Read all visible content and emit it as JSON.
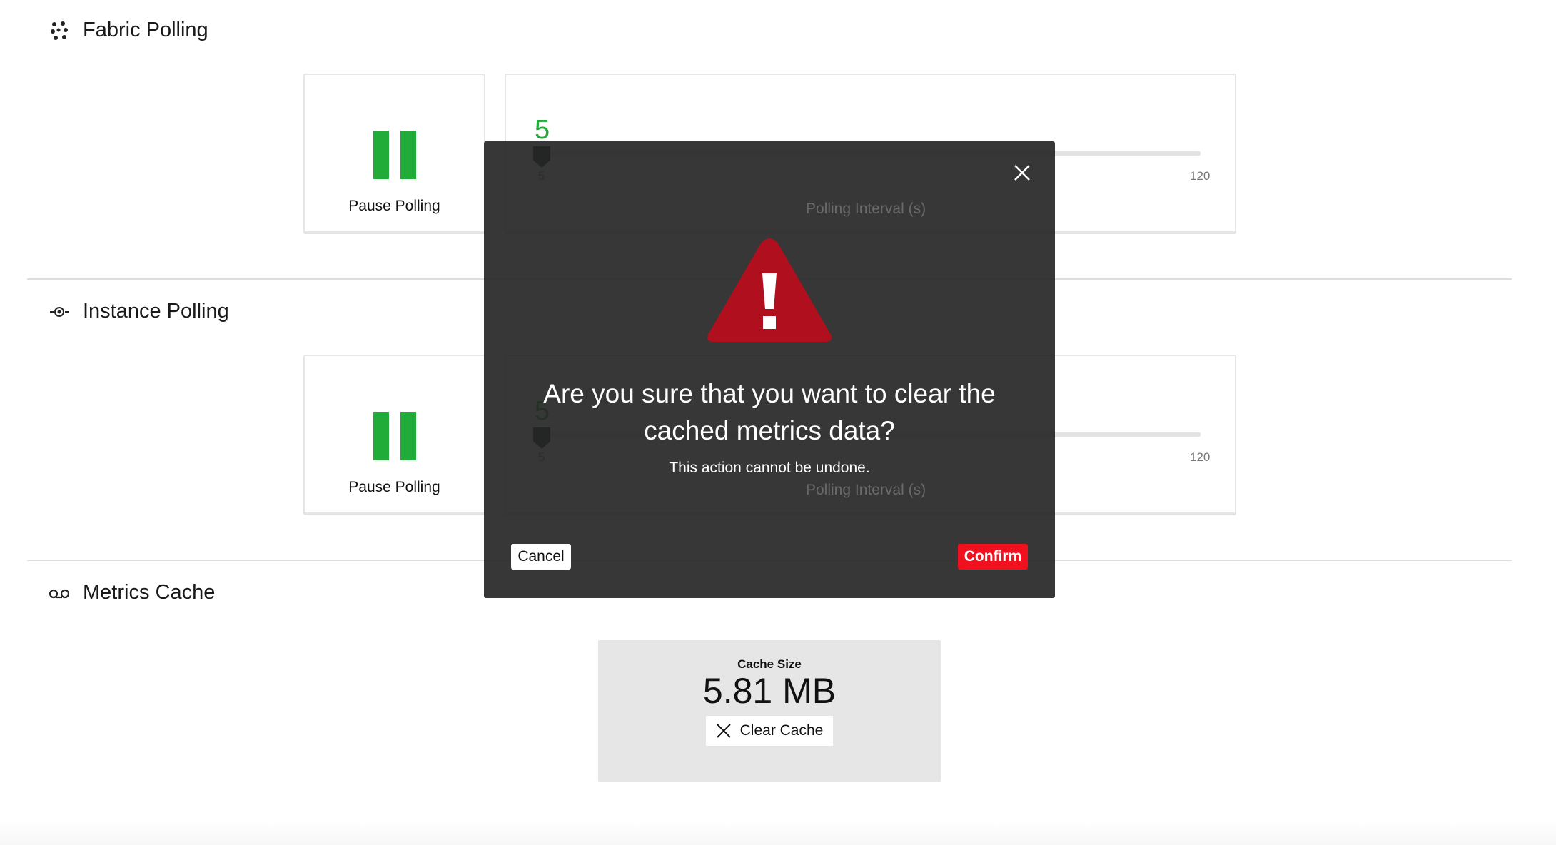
{
  "sections": [
    {
      "title": "Fabric Polling",
      "icon": "network-nodes-icon",
      "pause_label": "Pause Polling",
      "slider": {
        "value": 5,
        "min": 5,
        "max": 120,
        "value_label": "5",
        "min_label": "5",
        "max_label": "120",
        "label": "Polling Interval (s)"
      }
    },
    {
      "title": "Instance Polling",
      "icon": "instance-gear-icon",
      "pause_label": "Pause Polling",
      "slider": {
        "value": 5,
        "min": 5,
        "max": 120,
        "value_label": "5",
        "min_label": "5",
        "max_label": "120",
        "label": "Polling Interval (s)"
      }
    },
    {
      "title": "Metrics Cache",
      "icon": "cache-icon"
    }
  ],
  "cache": {
    "label": "Cache Size",
    "value": "5.81 MB",
    "clear_label": "Clear Cache"
  },
  "modal": {
    "title": "Are you sure that you want to clear the cached metrics data?",
    "subtitle": "This action cannot be undone.",
    "cancel": "Cancel",
    "confirm": "Confirm"
  },
  "colors": {
    "accent": "#22aa3a",
    "danger": "#f0101e",
    "warning": "#b0101e",
    "modal_bg": "#262626"
  }
}
